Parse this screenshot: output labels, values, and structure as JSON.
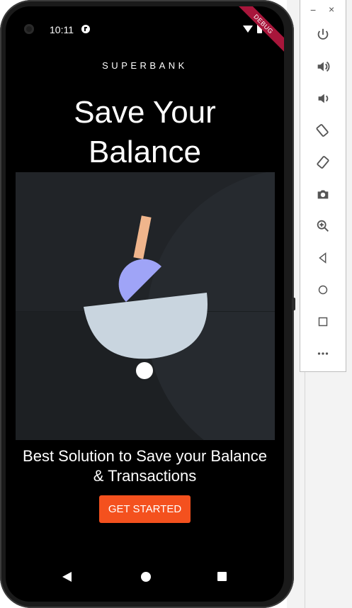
{
  "status_bar": {
    "time": "10:11",
    "debug_label": "DEBUG"
  },
  "app": {
    "brand": "SUPERBANK",
    "headline": "Save Your Balance",
    "tagline": "Best Solution to Save your Balance & Transactions",
    "cta_label": "GET STARTED"
  },
  "colors": {
    "screen_bg": "#000000",
    "illustration_bg": "#212428",
    "accent": "#f4511e",
    "bowl": "#c9d5df",
    "semicircle": "#9fa4f7",
    "stick": "#f0b58c"
  },
  "toolbar": {
    "minimize": "−",
    "close": "×",
    "buttons": [
      "power-icon",
      "volume-up-icon",
      "volume-down-icon",
      "rotate-left-icon",
      "rotate-right-icon",
      "camera-icon",
      "zoom-icon",
      "back-icon",
      "home-icon",
      "overview-icon",
      "more-icon"
    ]
  }
}
